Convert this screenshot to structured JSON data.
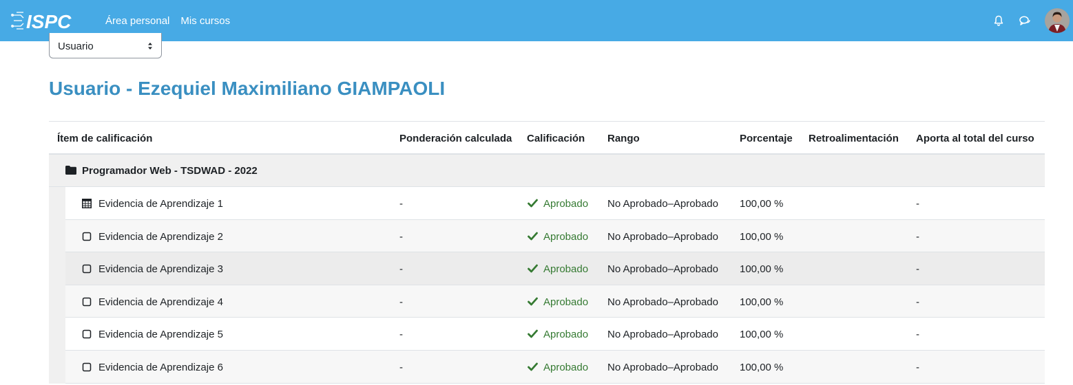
{
  "navbar": {
    "logo_text": "ISPC",
    "links": [
      "Área personal",
      "Mis cursos"
    ],
    "icons": [
      "bell-icon",
      "chat-icon"
    ],
    "colors": {
      "background": "#47aae5"
    }
  },
  "selector": {
    "value": "Usuario"
  },
  "page": {
    "title": "Usuario - Ezequiel Maximiliano GIAMPAOLI"
  },
  "table": {
    "headers": [
      "Ítem de calificación",
      "Ponderación calculada",
      "Calificación",
      "Rango",
      "Porcentaje",
      "Retroalimentación",
      "Aporta al total del curso"
    ],
    "category": "Programador Web - TSDWAD - 2022",
    "rows": [
      {
        "icon": "calculator-icon",
        "name": "Evidencia de Aprendizaje 1",
        "weight": "-",
        "grade": "Aprobado",
        "range": "No Aprobado–Aprobado",
        "percent": "100,00 %",
        "feedback": "",
        "contribution": "-"
      },
      {
        "icon": "checkbox-icon",
        "name": "Evidencia de Aprendizaje 2",
        "weight": "-",
        "grade": "Aprobado",
        "range": "No Aprobado–Aprobado",
        "percent": "100,00 %",
        "feedback": "",
        "contribution": "-"
      },
      {
        "icon": "checkbox-icon",
        "name": "Evidencia de Aprendizaje 3",
        "weight": "-",
        "grade": "Aprobado",
        "range": "No Aprobado–Aprobado",
        "percent": "100,00 %",
        "feedback": "",
        "contribution": "-"
      },
      {
        "icon": "checkbox-icon",
        "name": "Evidencia de Aprendizaje 4",
        "weight": "-",
        "grade": "Aprobado",
        "range": "No Aprobado–Aprobado",
        "percent": "100,00 %",
        "feedback": "",
        "contribution": "-"
      },
      {
        "icon": "checkbox-icon",
        "name": "Evidencia de Aprendizaje 5",
        "weight": "-",
        "grade": "Aprobado",
        "range": "No Aprobado–Aprobado",
        "percent": "100,00 %",
        "feedback": "",
        "contribution": "-"
      },
      {
        "icon": "checkbox-icon",
        "name": "Evidencia de Aprendizaje 6",
        "weight": "-",
        "grade": "Aprobado",
        "range": "No Aprobado–Aprobado",
        "percent": "100,00 %",
        "feedback": "",
        "contribution": "-"
      }
    ],
    "colors": {
      "title": "#3a8fc1",
      "grade_pass": "#357a32"
    }
  }
}
